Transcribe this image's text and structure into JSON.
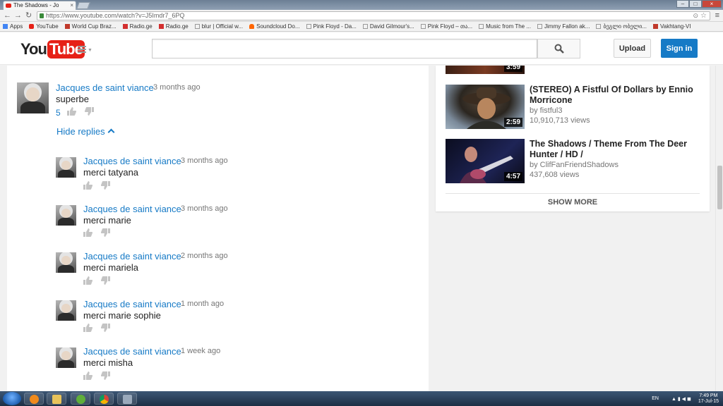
{
  "browser": {
    "tab_title": "The Shadows - Jo",
    "url": "https://www.youtube.com/watch?v=J5Imdr7_6PQ",
    "bookmarks": [
      {
        "label": "Apps",
        "color": "#4285f4"
      },
      {
        "label": "YouTube",
        "color": "#e62117"
      },
      {
        "label": "World Cup Braz...",
        "color": "#c0392b"
      },
      {
        "label": "Radio.ge",
        "color": "#d32f2f"
      },
      {
        "label": "Radio.ge",
        "color": "#d32f2f"
      },
      {
        "label": "blur | Official w...",
        "color": "#bbbbbb"
      },
      {
        "label": "Soundcloud Do...",
        "color": "#ff6600"
      },
      {
        "label": "Pink Floyd - Da...",
        "color": "#bbbbbb"
      },
      {
        "label": "David Gilmour's...",
        "color": "#bbbbbb"
      },
      {
        "label": "Pink Floyd – თა...",
        "color": "#bbbbbb"
      },
      {
        "label": "Music from The ...",
        "color": "#bbbbbb"
      },
      {
        "label": "Jimmy Fallon ak...",
        "color": "#bbbbbb"
      },
      {
        "label": "ბეგლი ობელი...",
        "color": "#bbbbbb"
      },
      {
        "label": "Vakhtang-VI",
        "color": "#c0392b"
      }
    ]
  },
  "header": {
    "logo_you": "You",
    "logo_tube": "Tube",
    "search_placeholder": "",
    "upload_label": "Upload",
    "signin_label": "Sign in"
  },
  "comments": {
    "top": {
      "author": "Jacques de saint viance",
      "time": "3 months ago",
      "text": "superbe",
      "likes": "5"
    },
    "hide_replies_label": "Hide replies",
    "replies": [
      {
        "author": "Jacques de saint viance",
        "time": "3 months ago",
        "text": "merci tatyana"
      },
      {
        "author": "Jacques de saint viance",
        "time": "3 months ago",
        "text": "merci marie"
      },
      {
        "author": "Jacques de saint viance",
        "time": "2 months ago",
        "text": "merci mariela"
      },
      {
        "author": "Jacques de saint viance",
        "time": "1 month ago",
        "text": "merci marie sophie"
      },
      {
        "author": "Jacques de saint viance",
        "time": "1 week ago",
        "text": "merci misha"
      }
    ]
  },
  "sidebar": {
    "partial_video_duration": "3:59",
    "videos": [
      {
        "title": "(STEREO) A Fistful Of Dollars by Ennio Morricone",
        "channel": "by fistful3",
        "views": "10,910,713 views",
        "duration": "2:59"
      },
      {
        "title": "The Shadows / Theme From The Deer Hunter / HD /",
        "channel": "by ClifFanFriendShadows",
        "views": "437,608 views",
        "duration": "4:57"
      }
    ],
    "show_more_label": "SHOW MORE"
  },
  "taskbar": {
    "lang": "EN",
    "time": "7:49 PM",
    "date": "17-Jul-15"
  }
}
